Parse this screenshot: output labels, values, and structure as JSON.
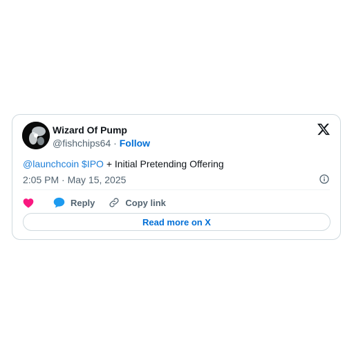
{
  "tweet": {
    "author": {
      "name": "Wizard Of Pump",
      "handle": "@fishchips64",
      "separator": "·",
      "follow_label": "Follow"
    },
    "text": {
      "mention": "@launchcoin",
      "cashtag": "$IPO",
      "rest": "+ Initial Pretending Offering"
    },
    "timestamp": "2:05 PM · May 15, 2025",
    "actions": {
      "like_icon": "heart-icon",
      "reply_label": "Reply",
      "reply_icon": "speech-bubble-icon",
      "copy_label": "Copy link",
      "copy_icon": "link-icon"
    },
    "read_more_label": "Read more on X",
    "icons": {
      "brand": "x-logo-icon",
      "info": "info-icon"
    }
  },
  "colors": {
    "link": "#1d7fd9",
    "follow": "#006fd6",
    "like": "#f91880",
    "reply": "#1d9bf0",
    "muted": "#536471",
    "border": "#cfd9de"
  }
}
